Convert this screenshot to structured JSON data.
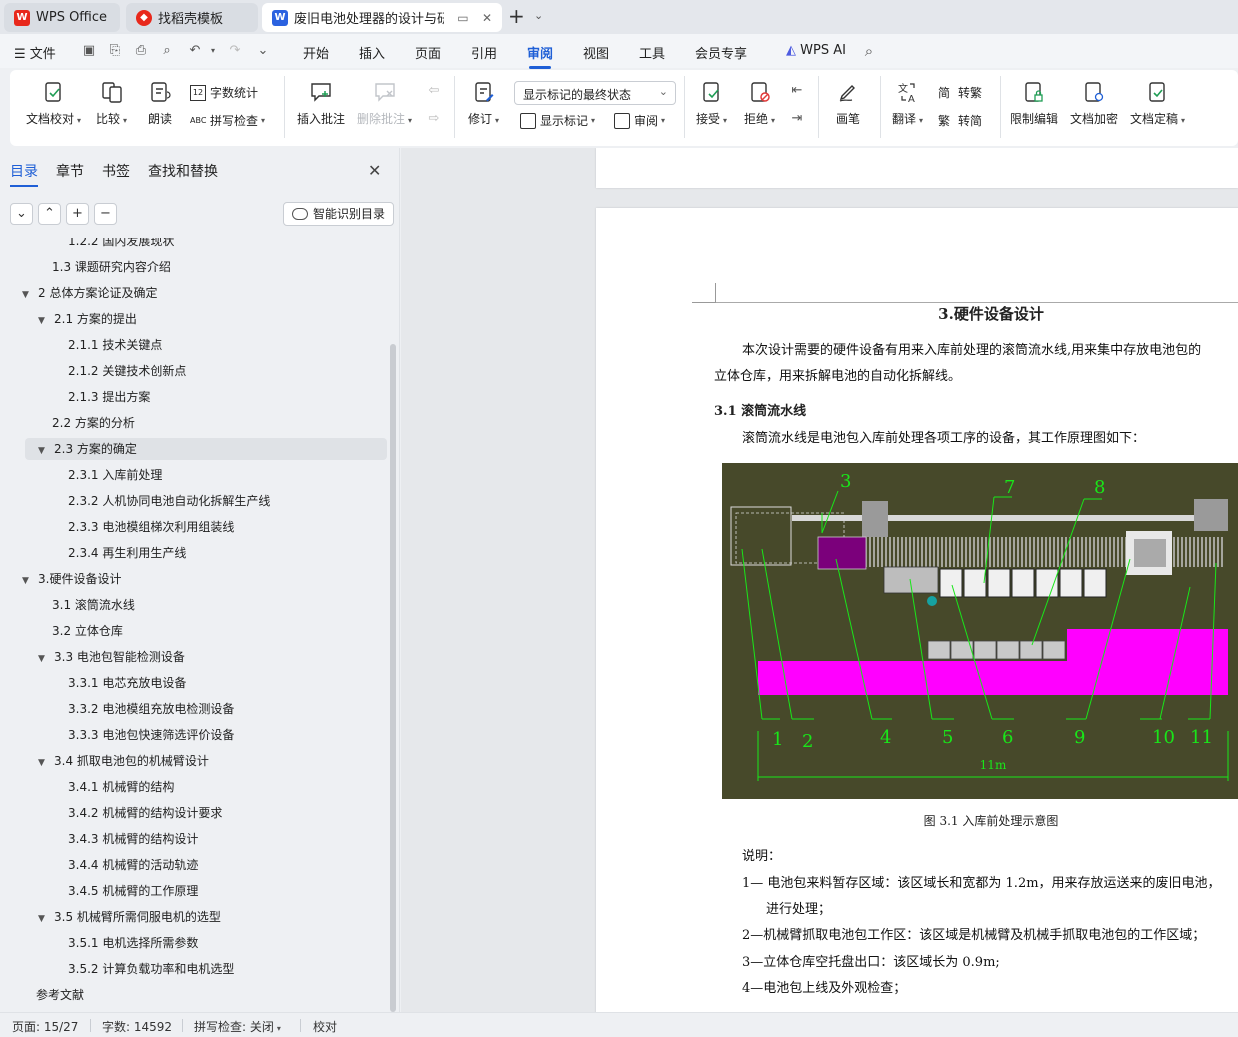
{
  "tabs": [
    {
      "label": "WPS Office",
      "icon": "wps-logo-icon",
      "color": "#e8281b"
    },
    {
      "label": "找稻壳模板",
      "icon": "docer-logo-icon",
      "color": "#e8281b"
    },
    {
      "label": "废旧电池处理器的设计与研究",
      "icon": "word-doc-icon",
      "color": "#2b62e0"
    }
  ],
  "menubar": {
    "file": "文件",
    "items": [
      "开始",
      "插入",
      "页面",
      "引用",
      "审阅",
      "视图",
      "工具",
      "会员专享"
    ],
    "active": "审阅",
    "wps_ai": "WPS AI"
  },
  "ribbon": {
    "proofread": "文档校对",
    "compare": "比较",
    "read_aloud": "朗读",
    "word_count": "字数统计",
    "spell_check": "拼写检查",
    "insert_comment": "插入批注",
    "delete_comment": "删除批注",
    "markup_select": "显示标记的最终状态",
    "track_changes": "修订",
    "show_markup": "显示标记",
    "review_pane": "审阅",
    "accept": "接受",
    "reject": "拒绝",
    "ink": "画笔",
    "translate": "翻译",
    "to_traditional": "转繁",
    "to_simplified": "转简",
    "restrict_edit": "限制编辑",
    "encrypt": "文档加密",
    "finalize": "文档定稿"
  },
  "nav": {
    "tabs": [
      "目录",
      "章节",
      "书签",
      "查找和替换"
    ],
    "smart_toc": "智能识别目录",
    "toc": [
      {
        "label": "1.2.2 国内发展现状",
        "level": 3,
        "expand": ""
      },
      {
        "label": "1.3  课题研究内容介绍",
        "level": 2,
        "expand": ""
      },
      {
        "label": "2  总体方案论证及确定",
        "level": 1,
        "expand": "▼"
      },
      {
        "label": "2.1 方案的提出",
        "level": 2,
        "expand": "▼"
      },
      {
        "label": "2.1.1 技术关键点",
        "level": 3,
        "expand": ""
      },
      {
        "label": "2.1.2 关键技术创新点",
        "level": 3,
        "expand": ""
      },
      {
        "label": "2.1.3 提出方案",
        "level": 3,
        "expand": ""
      },
      {
        "label": "2.2 方案的分析",
        "level": 2,
        "expand": ""
      },
      {
        "label": "2.3 方案的确定",
        "level": 2,
        "expand": "▼",
        "selected": true
      },
      {
        "label": "2.3.1 入库前处理",
        "level": 3,
        "expand": ""
      },
      {
        "label": "2.3.2 人机协同电池自动化拆解生产线",
        "level": 3,
        "expand": ""
      },
      {
        "label": "2.3.3 电池模组梯次利用组装线",
        "level": 3,
        "expand": ""
      },
      {
        "label": "2.3.4 再生利用生产线",
        "level": 3,
        "expand": ""
      },
      {
        "label": "3.硬件设备设计",
        "level": 1,
        "expand": "▼"
      },
      {
        "label": "3.1 滚筒流水线",
        "level": 2,
        "expand": ""
      },
      {
        "label": "3.2 立体仓库",
        "level": 2,
        "expand": ""
      },
      {
        "label": "3.3 电池包智能检测设备",
        "level": 2,
        "expand": "▼"
      },
      {
        "label": "3.3.1 电芯充放电设备",
        "level": 3,
        "expand": ""
      },
      {
        "label": "3.3.2 电池模组充放电检测设备",
        "level": 3,
        "expand": ""
      },
      {
        "label": "3.3.3 电池包快速筛选评价设备",
        "level": 3,
        "expand": ""
      },
      {
        "label": "3.4 抓取电池包的机械臂设计",
        "level": 2,
        "expand": "▼"
      },
      {
        "label": "3.4.1 机械臂的结构",
        "level": 3,
        "expand": ""
      },
      {
        "label": "3.4.2 机械臂的结构设计要求",
        "level": 3,
        "expand": ""
      },
      {
        "label": "3.4.3 机械臂的结构设计",
        "level": 3,
        "expand": ""
      },
      {
        "label": "3.4.4 机械臂的活动轨迹",
        "level": 3,
        "expand": ""
      },
      {
        "label": "3.4.5 机械臂的工作原理",
        "level": 3,
        "expand": ""
      },
      {
        "label": "3.5 机械臂所需伺服电机的选型",
        "level": 2,
        "expand": "▼"
      },
      {
        "label": "3.5.1 电机选择所需参数",
        "level": 3,
        "expand": ""
      },
      {
        "label": "3.5.2 计算负载功率和电机选型",
        "level": 3,
        "expand": ""
      },
      {
        "label": "参考文献",
        "level": 1,
        "expand": ""
      }
    ]
  },
  "doc": {
    "heading": "3.硬件设备设计",
    "intro_1": "本次设计需要的硬件设备有用来入库前处理的滚筒流水线,用来集中存放电池包的",
    "intro_2": "立体仓库，用来拆解电池的自动化拆解线。",
    "section_31": "3.1 滚筒流水线",
    "section_31_text": "滚筒流水线是电池包入库前处理各项工序的设备，其工作原理图如下：",
    "figure_numbers": [
      "1",
      "2",
      "3",
      "4",
      "5",
      "6",
      "7",
      "8",
      "9",
      "10",
      "11"
    ],
    "figure_dim": "11m",
    "caption": "图 3.1  入库前处理示意图",
    "note_title": "说明：",
    "notes": [
      "1— 电池包来料暂存区域：该区域长和宽都为 1.2m，用来存放运送来的废旧电池，",
      "进行处理；",
      "2—机械臂抓取电池包工作区：该区域是机械臂及机械手抓取电池包的工作区域；",
      "3—立体仓库空托盘出口：该区域长为 0.9m;",
      "4—电池包上线及外观检查；"
    ]
  },
  "status": {
    "page": "页面: 15/27",
    "words": "字数: 14592",
    "spell": "拼写检查: 关闭",
    "proof": "校对"
  },
  "colors": {
    "accent": "#1f5fd6",
    "figure_bg": "#47492a",
    "figure_magenta": "#ff00ff",
    "figure_green": "#19e619"
  }
}
